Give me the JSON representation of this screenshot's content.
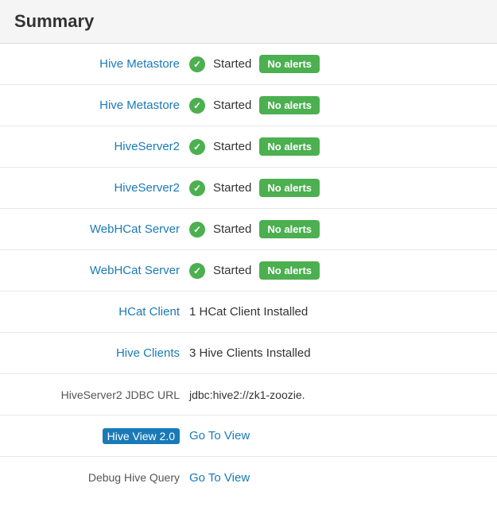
{
  "header": {
    "title": "Summary"
  },
  "rows": [
    {
      "id": "hive-metastore-1",
      "label": "Hive Metastore",
      "label_type": "link",
      "status": "Started",
      "badge": "No alerts",
      "show_status": true,
      "show_badge": true
    },
    {
      "id": "hive-metastore-2",
      "label": "Hive Metastore",
      "label_type": "link",
      "status": "Started",
      "badge": "No alerts",
      "show_status": true,
      "show_badge": true
    },
    {
      "id": "hiveserver2-1",
      "label": "HiveServer2",
      "label_type": "link",
      "status": "Started",
      "badge": "No alerts",
      "show_status": true,
      "show_badge": true
    },
    {
      "id": "hiveserver2-2",
      "label": "HiveServer2",
      "label_type": "link",
      "status": "Started",
      "badge": "No alerts",
      "show_status": true,
      "show_badge": true
    },
    {
      "id": "webhcat-server-1",
      "label": "WebHCat Server",
      "label_type": "link",
      "status": "Started",
      "badge": "No alerts",
      "show_status": true,
      "show_badge": true
    },
    {
      "id": "webhcat-server-2",
      "label": "WebHCat Server",
      "label_type": "link",
      "status": "Started",
      "badge": "No alerts",
      "show_status": true,
      "show_badge": true
    },
    {
      "id": "hcat-client",
      "label": "HCat Client",
      "label_type": "link",
      "info_text": "1 HCat Client Installed",
      "show_status": false,
      "show_badge": false
    },
    {
      "id": "hive-clients",
      "label": "Hive Clients",
      "label_type": "link",
      "info_text": "3 Hive Clients Installed",
      "show_status": false,
      "show_badge": false
    },
    {
      "id": "hiveserver2-jdbc",
      "label": "HiveServer2 JDBC URL",
      "label_type": "plain",
      "info_text": "jdbc:hive2://zk1-zoozie.",
      "show_status": false,
      "show_badge": false
    },
    {
      "id": "hive-view-2",
      "label": "Hive View 2.0",
      "label_type": "highlighted",
      "goto_text": "Go To View",
      "show_status": false,
      "show_badge": false
    },
    {
      "id": "debug-hive-query",
      "label": "Debug Hive Query",
      "label_type": "plain",
      "goto_text": "Go To View",
      "show_status": false,
      "show_badge": false
    }
  ],
  "icons": {
    "checkmark": "✓"
  },
  "colors": {
    "green": "#4caf50",
    "link_blue": "#1a7ab8",
    "highlight_blue": "#1a7ab8"
  }
}
